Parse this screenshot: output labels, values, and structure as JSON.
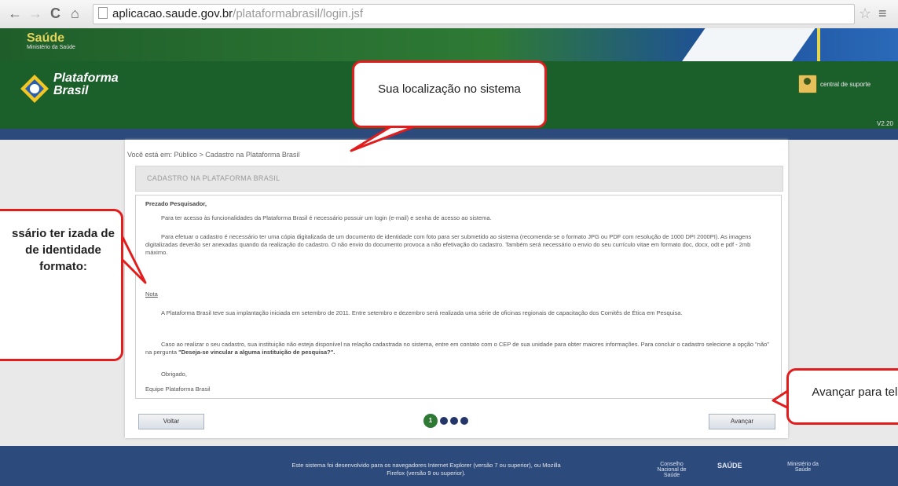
{
  "browser": {
    "back_glyph": "←",
    "forward_glyph": "→",
    "reload_glyph": "C",
    "home_glyph": "⌂",
    "url_host": "aplicacao.saude.gov.br",
    "url_path": "/plataformabrasil/login.jsf",
    "star_glyph": "☆",
    "menu_glyph": "≡"
  },
  "banner": {
    "brand": "Saúde",
    "ministry": "Ministério da Saúde"
  },
  "header": {
    "logo_text": "Plataforma Brasil",
    "support_label": "central de suporte",
    "version": "V2.20"
  },
  "content": {
    "breadcrumb": "Você está em: Público > Cadastro na Plataforma Brasil",
    "section_title": "CADASTRO NA PLATAFORMA BRASIL",
    "greeting": "Prezado Pesquisador,",
    "p1": "Para ter acesso às funcionalidades da Plataforma Brasil é necessário possuir um login (e-mail) e senha de acesso ao sistema.",
    "p2": "Para efetuar o cadastro é necessário ter uma cópia digitalizada de um documento de identidade com foto para ser submetido ao sistema (recomenda-se o formato JPG ou PDF com resolução de 1000 DPI 2000PI). As imagens digitalizadas deverão ser anexadas quando da realização do cadastro. O não envio do documento provoca a não efetivação do cadastro. Também será necessário o envio do seu currículo vitae em formato doc, docx, odt e pdf - 2mb máximo.",
    "nota": "Nota",
    "p3": "A Plataforma Brasil teve sua implantação iniciada em setembro de 2011. Entre setembro e dezembro será realizada uma série de oficinas regionais de capacitação dos Comitês de Ética em Pesquisa.",
    "p4": "Caso ao realizar o seu cadastro, sua instituição não esteja disponível na relação cadastrada no sistema, entre em contato com o CEP de sua unidade para obter maiores informações. Para concluir o cadastro selecione a opção \"não\" na pergunta ",
    "p4_bold": "\"Deseja-se vincular a alguma instituição de pesquisa?\".",
    "thanks": "Obrigado,",
    "team": "Equipe Plataforma Brasil",
    "back_button": "Voltar",
    "next_button": "Avançar",
    "current_step": "1",
    "total_steps": 4
  },
  "footer": {
    "text": "Este sistema foi desenvolvido para os navegadores Internet Explorer (versão 7 ou superior), ou Mozilla Firefox (versão 9 ou superior).",
    "logo1": "Conselho Nacional de Saúde",
    "logo2": "SAÚDE",
    "logo3": "Ministério da Saúde"
  },
  "callouts": {
    "location": "Sua localização no sistema",
    "document": "ssário ter izada de de identidade formato:",
    "next": "Avançar para tela"
  },
  "colors": {
    "callout_border": "#e21d1d",
    "header_green": "#1b5f2b",
    "footer_blue": "#2c4a7c"
  }
}
